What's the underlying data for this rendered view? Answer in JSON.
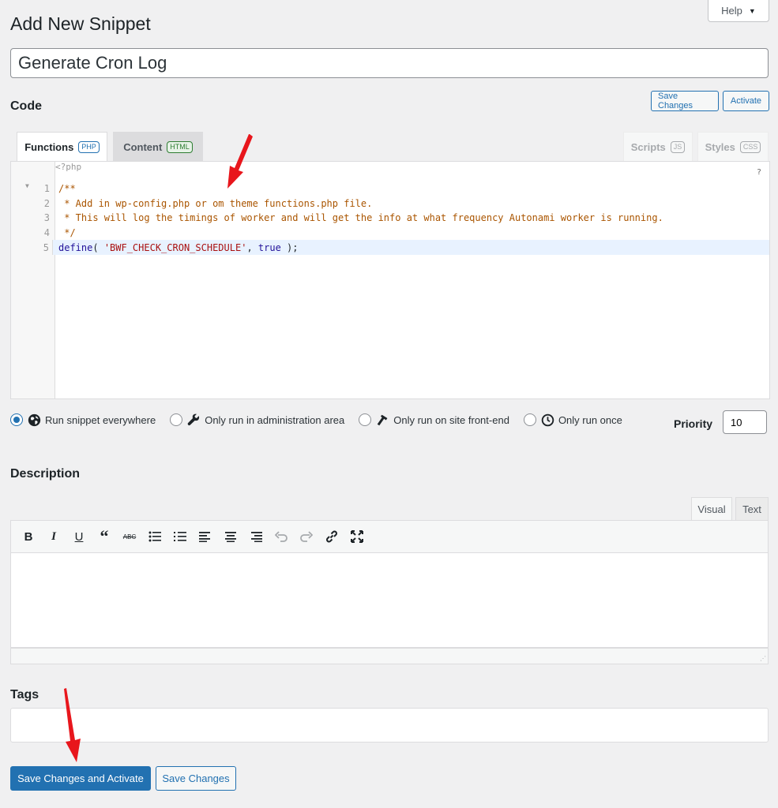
{
  "header": {
    "help_label": "Help",
    "page_title": "Add New Snippet"
  },
  "snippet": {
    "title_value": "Generate Cron Log"
  },
  "code_section": {
    "heading": "Code",
    "save_changes": "Save Changes",
    "activate": "Activate",
    "tabs": [
      {
        "label": "Functions",
        "badge": "PHP"
      },
      {
        "label": "Content",
        "badge": "HTML"
      },
      {
        "label": "Scripts",
        "badge": "JS"
      },
      {
        "label": "Styles",
        "badge": "CSS"
      }
    ],
    "php_open": "<?php",
    "help_mark": "?",
    "lines": [
      {
        "num": "1",
        "text": "/**"
      },
      {
        "num": "2",
        "text": " * Add in wp-config.php or om theme functions.php file."
      },
      {
        "num": "3",
        "text": " * This will log the timings of worker and will get the info at what frequency Autonami worker is running."
      },
      {
        "num": "4",
        "text": " */"
      },
      {
        "num": "5",
        "kw": "define",
        "p1": "( ",
        "str": "'BWF_CHECK_CRON_SCHEDULE'",
        "p2": ", ",
        "atom": "true",
        "p3": " );"
      }
    ]
  },
  "scope": {
    "options": [
      {
        "label": "Run snippet everywhere",
        "icon": "globe-icon",
        "selected": true
      },
      {
        "label": "Only run in administration area",
        "icon": "wrench-icon",
        "selected": false
      },
      {
        "label": "Only run on site front-end",
        "icon": "hammer-icon",
        "selected": false
      },
      {
        "label": "Only run once",
        "icon": "clock-icon",
        "selected": false
      }
    ],
    "priority_label": "Priority",
    "priority_value": "10"
  },
  "description": {
    "heading": "Description",
    "tab_visual": "Visual",
    "tab_text": "Text"
  },
  "tags": {
    "heading": "Tags"
  },
  "footer": {
    "save_activate": "Save Changes and Activate",
    "save": "Save Changes"
  },
  "colors": {
    "accent": "#2271b1",
    "comment": "#aa5500",
    "string": "#a11",
    "keyword": "#708",
    "arrow": "#e8161c"
  }
}
